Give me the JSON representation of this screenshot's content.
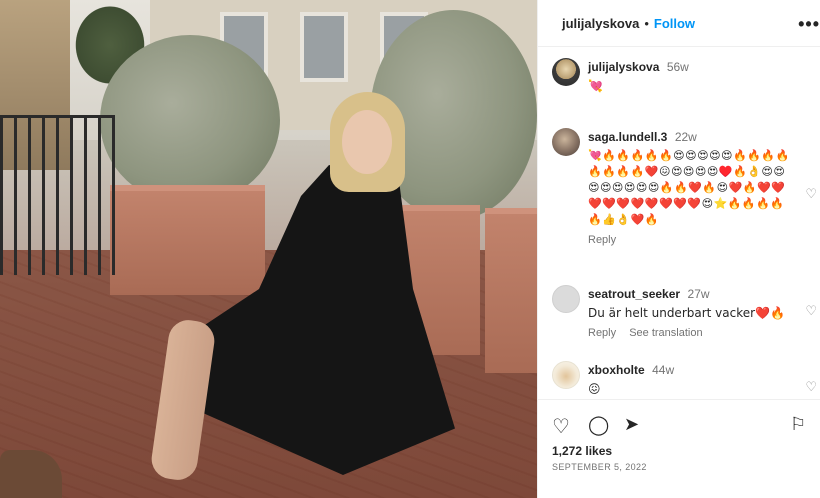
{
  "post": {
    "author": "julijalyskova",
    "separator": "•",
    "follow_label": "Follow",
    "more_icon": "•••",
    "likes": "1,272 likes",
    "date": "SEPTEMBER 5, 2022"
  },
  "caption": {
    "username": "julijalyskova",
    "time": "56w",
    "text": "💘"
  },
  "comments": [
    {
      "username": "saga.lundell.3",
      "time": "22w",
      "text": "💘🔥🔥🔥🔥🔥😍😍😍😍😍🔥🔥🔥🔥🔥🔥🔥🔥❤️😖😍😍😍😍♥️🔥👌😍😍😍😍😍😍😍😍🔥🔥❤️🔥😍❤️🔥❤️❤️❤️❤️❤️❤️❤️❤️❤️❤️😍⭐🔥🔥🔥🔥🔥👍👌❤️🔥",
      "reply_label": "Reply"
    },
    {
      "username": "seatrout_seeker",
      "time": "27w",
      "text": "Du är helt underbart vacker❤️🔥",
      "reply_label": "Reply",
      "translation_label": "See translation"
    },
    {
      "username": "xboxholte",
      "time": "44w",
      "text": "😖"
    }
  ],
  "icons": {
    "like": "♡",
    "comment": "◯",
    "share": "➤",
    "save": "⚐",
    "comment_like": "♡"
  },
  "colors": {
    "follow": "#0095f6",
    "text": "#262626",
    "muted": "#737373"
  }
}
